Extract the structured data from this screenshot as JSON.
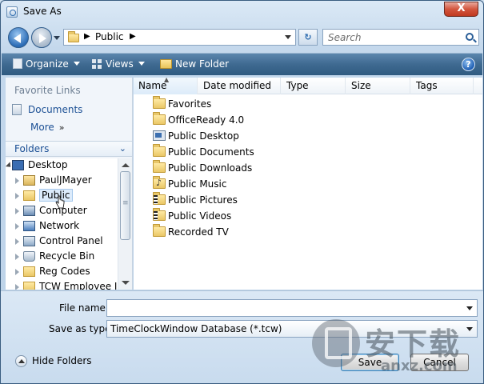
{
  "window": {
    "title": "Save As",
    "close_glyph": "X"
  },
  "nav": {
    "address_path": "Public",
    "search_placeholder": "Search",
    "refresh_glyph": "↻"
  },
  "toolbar": {
    "organize": "Organize",
    "views": "Views",
    "new_folder": "New Folder",
    "help_glyph": "?"
  },
  "favorites": {
    "title": "Favorite Links",
    "items": [
      "Documents"
    ],
    "more": "More",
    "more_glyph": "»"
  },
  "folders": {
    "header": "Folders",
    "chevron": "⌄",
    "tree": [
      {
        "label": "Desktop",
        "icon": "desktop-icon",
        "level": 0
      },
      {
        "label": "PaulJMayer",
        "icon": "user-icon",
        "level": 1
      },
      {
        "label": "Public",
        "icon": "folder-icon",
        "level": 1,
        "selected": true
      },
      {
        "label": "Computer",
        "icon": "computer-icon",
        "level": 1
      },
      {
        "label": "Network",
        "icon": "network-icon",
        "level": 1
      },
      {
        "label": "Control Panel",
        "icon": "control-panel-icon",
        "level": 1
      },
      {
        "label": "Recycle Bin",
        "icon": "recycle-bin-icon",
        "level": 1
      },
      {
        "label": "Reg Codes",
        "icon": "folder-icon",
        "level": 1
      },
      {
        "label": "TCW Employee Int",
        "icon": "folder-icon",
        "level": 1
      }
    ]
  },
  "columns": [
    "Name",
    "Date modified",
    "Type",
    "Size",
    "Tags"
  ],
  "files": [
    {
      "name": "Favorites",
      "icon": "folder"
    },
    {
      "name": "OfficeReady 4.0",
      "icon": "folder"
    },
    {
      "name": "Public Desktop",
      "icon": "desktop"
    },
    {
      "name": "Public Documents",
      "icon": "folder"
    },
    {
      "name": "Public Downloads",
      "icon": "folder"
    },
    {
      "name": "Public Music",
      "icon": "music"
    },
    {
      "name": "Public Pictures",
      "icon": "pics"
    },
    {
      "name": "Public Videos",
      "icon": "pics"
    },
    {
      "name": "Recorded TV",
      "icon": "folder"
    }
  ],
  "form": {
    "file_name_label": "File name:",
    "file_name_value": "",
    "save_as_type_label": "Save as type:",
    "save_as_type_value": "TimeClockWindow Database (*.tcw)"
  },
  "footer": {
    "hide_folders": "Hide Folders",
    "save": "Save",
    "cancel": "Cancel"
  },
  "watermark": {
    "logo_text": "安下载",
    "sub_text": "anxz.com"
  }
}
